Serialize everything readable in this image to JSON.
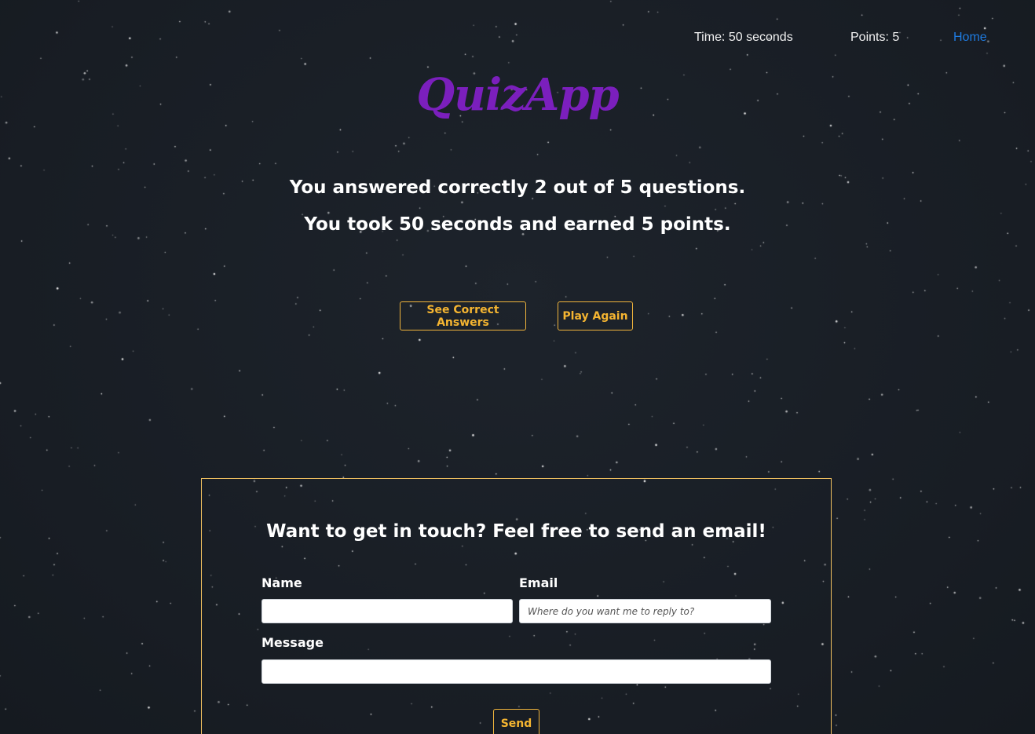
{
  "nav": {
    "time": "Time: 50 seconds",
    "points": "Points: 5",
    "home": "Home"
  },
  "app_title": "QuizApp",
  "results": {
    "line1": "You answered correctly 2 out of 5 questions.",
    "line2": "You took 50 seconds and earned 5 points."
  },
  "actions": {
    "see_answers": "See Correct Answers",
    "play_again": "Play Again"
  },
  "contact": {
    "title": "Want to get in touch? Feel free to send an email!",
    "name_label": "Name",
    "name_value": "",
    "email_label": "Email",
    "email_placeholder": "Where do you want me to reply to?",
    "message_label": "Message",
    "message_value": "",
    "send": "Send"
  },
  "colors": {
    "background": "#1a1f27",
    "title": "#7b1fbd",
    "accent": "#f5b531",
    "link": "#1f7be0"
  }
}
